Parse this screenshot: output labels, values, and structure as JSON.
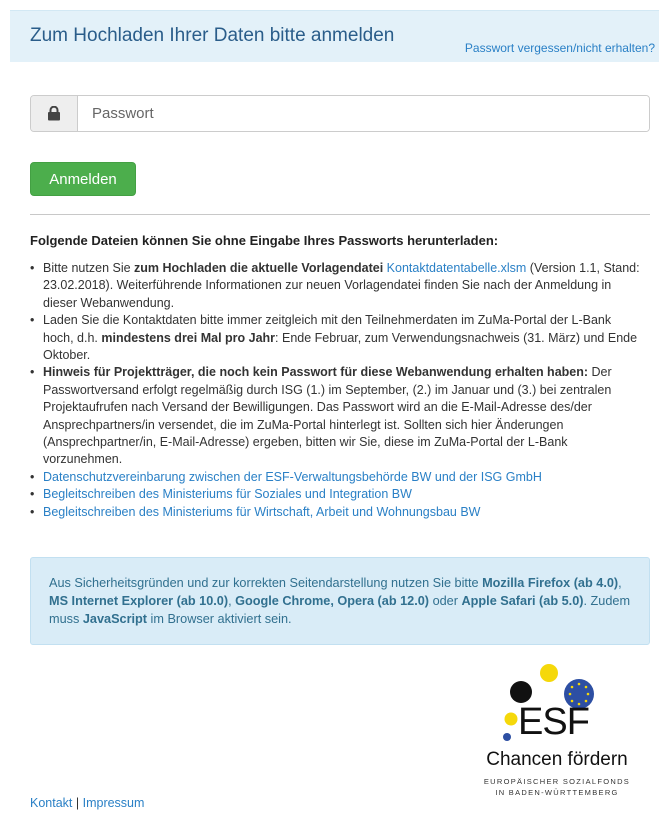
{
  "header": {
    "title": "Zum Hochladen Ihrer Daten bitte anmelden",
    "forgot_link": "Passwort vergessen/nicht erhalten?"
  },
  "login": {
    "password_placeholder": "Passwort",
    "password_icon": "lock-icon",
    "submit_label": "Anmelden"
  },
  "downloads": {
    "heading": "Folgende Dateien können Sie ohne Eingabe Ihres Passworts herunterladen:",
    "item1": {
      "t1": "Bitte nutzen Sie ",
      "b1": "zum Hochladen die aktuelle Vorlagendatei",
      "t2": " ",
      "link": "Kontaktdatentabelle.xlsm",
      "t3": " (Version 1.1, Stand: 23.02.2018). Weiterführende Informationen zur neuen Vorlagendatei finden Sie nach der Anmeldung in dieser Webanwendung."
    },
    "item2": {
      "t1": "Laden Sie die Kontaktdaten bitte immer zeitgleich mit den Teilnehmerdaten im ZuMa-Portal der L-Bank hoch, d.h. ",
      "b1": "mindestens drei Mal pro Jahr",
      "t2": ": Ende Februar, zum Verwendungsnachweis (31. März) und Ende Oktober."
    },
    "item3": {
      "b1": "Hinweis für Projektträger, die noch kein Passwort für diese Webanwendung erhalten haben:",
      "t1": " Der Passwortversand erfolgt regelmäßig durch ISG (1.) im September, (2.) im Januar und (3.) bei zentralen Projektaufrufen nach Versand der Bewilligungen. Das Passwort wird an die E-Mail-Adresse des/der Ansprechpartners/in versendet, die im ZuMa-Portal hinterlegt ist. Sollten sich hier Änderungen (Ansprechpartner/in, E-Mail-Adresse) ergeben, bitten wir Sie, diese im ZuMa-Portal der L-Bank vorzunehmen."
    },
    "link4": "Datenschutzvereinbarung zwischen der ESF-Verwaltungsbehörde BW und der ISG GmbH",
    "link5": "Begleitschreiben des Ministeriums für Soziales und Integration BW",
    "link6": "Begleitschreiben des Ministeriums für Wirtschaft, Arbeit und Wohnungsbau BW"
  },
  "info": {
    "t1": "Aus Sicherheitsgründen und zur korrekten Seitendarstellung nutzen Sie bitte ",
    "b1": "Mozilla Firefox (ab 4.0)",
    "t2": ", ",
    "b2": "MS Internet Explorer (ab 10.0)",
    "t3": ", ",
    "b3": "Google Chrome, Opera (ab 12.0)",
    "t4": " oder ",
    "b4": "Apple Safari (ab 5.0)",
    "t5": ". Zudem muss ",
    "b5": "JavaScript",
    "t6": " im Browser aktiviert sein."
  },
  "logo": {
    "esf": "ESF",
    "tagline": "Chancen fördern",
    "sub1": "EUROPÄISCHER SOZIALFONDS",
    "sub2": "IN BADEN-WÜRTTEMBERG",
    "colors": {
      "yellow": "#f5d80a",
      "blue": "#2d4fa3",
      "black": "#111111"
    }
  },
  "footer": {
    "kontakt": "Kontakt",
    "separator": "|",
    "impressum": "Impressum"
  }
}
